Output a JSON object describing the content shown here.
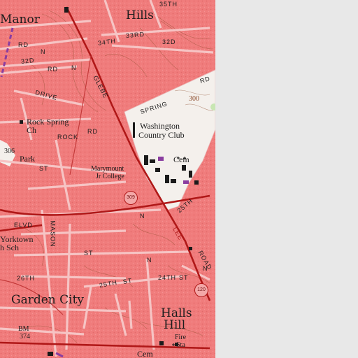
{
  "map": {
    "colors": {
      "urban_tint": "#f07c7c",
      "urban_dark": "#e06262",
      "contour": "#8b4a2a",
      "major_road": "#b01818",
      "local_road": "#f6c4c4",
      "open_land": "#f4f0ec",
      "boundary_purple": "#8a3da0",
      "background": "#e8e8e8"
    },
    "places": {
      "manor": "Manor",
      "hills": "Hills",
      "washington_country_club_line1": "Washington",
      "washington_country_club_line2": "Country Club",
      "cem_1": "Cem",
      "marymount_line1": "Marymount",
      "marymount_line2": "Jr College",
      "rock_spring_line1": "Rock Spring",
      "rock_spring_line2": "Ch",
      "park": "Park",
      "yorktown_line1": "Yorktown",
      "yorktown_line2": "h Sch",
      "garden_city": "Garden City",
      "halls_line1": "Halls",
      "halls_line2": "Hill",
      "fire_line1": "Fire",
      "fire_line2": "Sta",
      "cem_2": "Cem",
      "bm": "BM",
      "bm_elev": "374",
      "elev_306": "306",
      "elev_300": "300"
    },
    "streets": {
      "s_35th": "35TH",
      "s_34th": "34TH",
      "s_33rd": "33RD",
      "s_32d": "32D",
      "s_32d_rd": "32D",
      "rd_1": "RD",
      "n_1": "N",
      "rd_2": "RD",
      "n_2": "N",
      "rock_drive": "DRIVE",
      "rock_rd": "ROCK",
      "rd_rock": "RD",
      "glebe": "GLEBE",
      "spring": "SPRING",
      "rd_spring": "RD",
      "st_1": "ST",
      "elvd": "ELVD",
      "mason": "MASON",
      "st_2": "ST",
      "n_st": "N",
      "s_26th": "26TH",
      "s_25th": "25TH",
      "st_25": "ST",
      "s_24th": "24TH",
      "st_24": "ST",
      "lee": "LEE",
      "road": "ROAD",
      "s_25th_b": "25TH",
      "n_3": "N",
      "n_4": "N"
    },
    "route_shields": {
      "r1": "309",
      "r2": "120"
    }
  }
}
